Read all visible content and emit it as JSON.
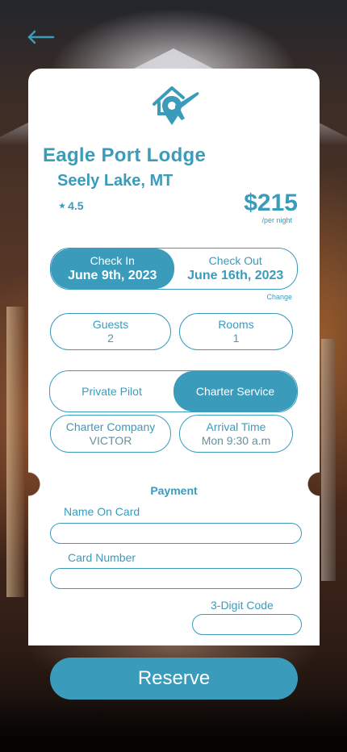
{
  "colors": {
    "accent": "#3b9bbb",
    "card": "#ffffff"
  },
  "header": {
    "back_icon": "arrow-left-icon"
  },
  "logo": {
    "icon": "home-location-plane-icon"
  },
  "lodge": {
    "name": "Eagle Port Lodge",
    "location": "Seely Lake, MT",
    "rating_star": "★",
    "rating": "4.5",
    "price": "$215",
    "price_unit": "/per night"
  },
  "dates": {
    "check_in_label": "Check In",
    "check_in_value": "June 9th, 2023",
    "check_out_label": "Check Out",
    "check_out_value": "June 16th, 2023",
    "change_label": "Change",
    "active": "check_in"
  },
  "occupancy": {
    "guests_label": "Guests",
    "guests_value": "2",
    "rooms_label": "Rooms",
    "rooms_value": "1"
  },
  "service": {
    "options": [
      "Private Pilot",
      "Charter Service"
    ],
    "selected": "Charter Service"
  },
  "charter": {
    "company_label": "Charter Company",
    "company_value": "VICTOR",
    "arrival_label": "Arrival Time",
    "arrival_value": "Mon 9:30 a.m"
  },
  "payment": {
    "title": "Payment",
    "name_label": "Name On Card",
    "name_value": "",
    "number_label": "Card Number",
    "number_value": "",
    "cvv_label": "3-Digit Code",
    "cvv_value": ""
  },
  "actions": {
    "reserve_label": "Reserve"
  }
}
